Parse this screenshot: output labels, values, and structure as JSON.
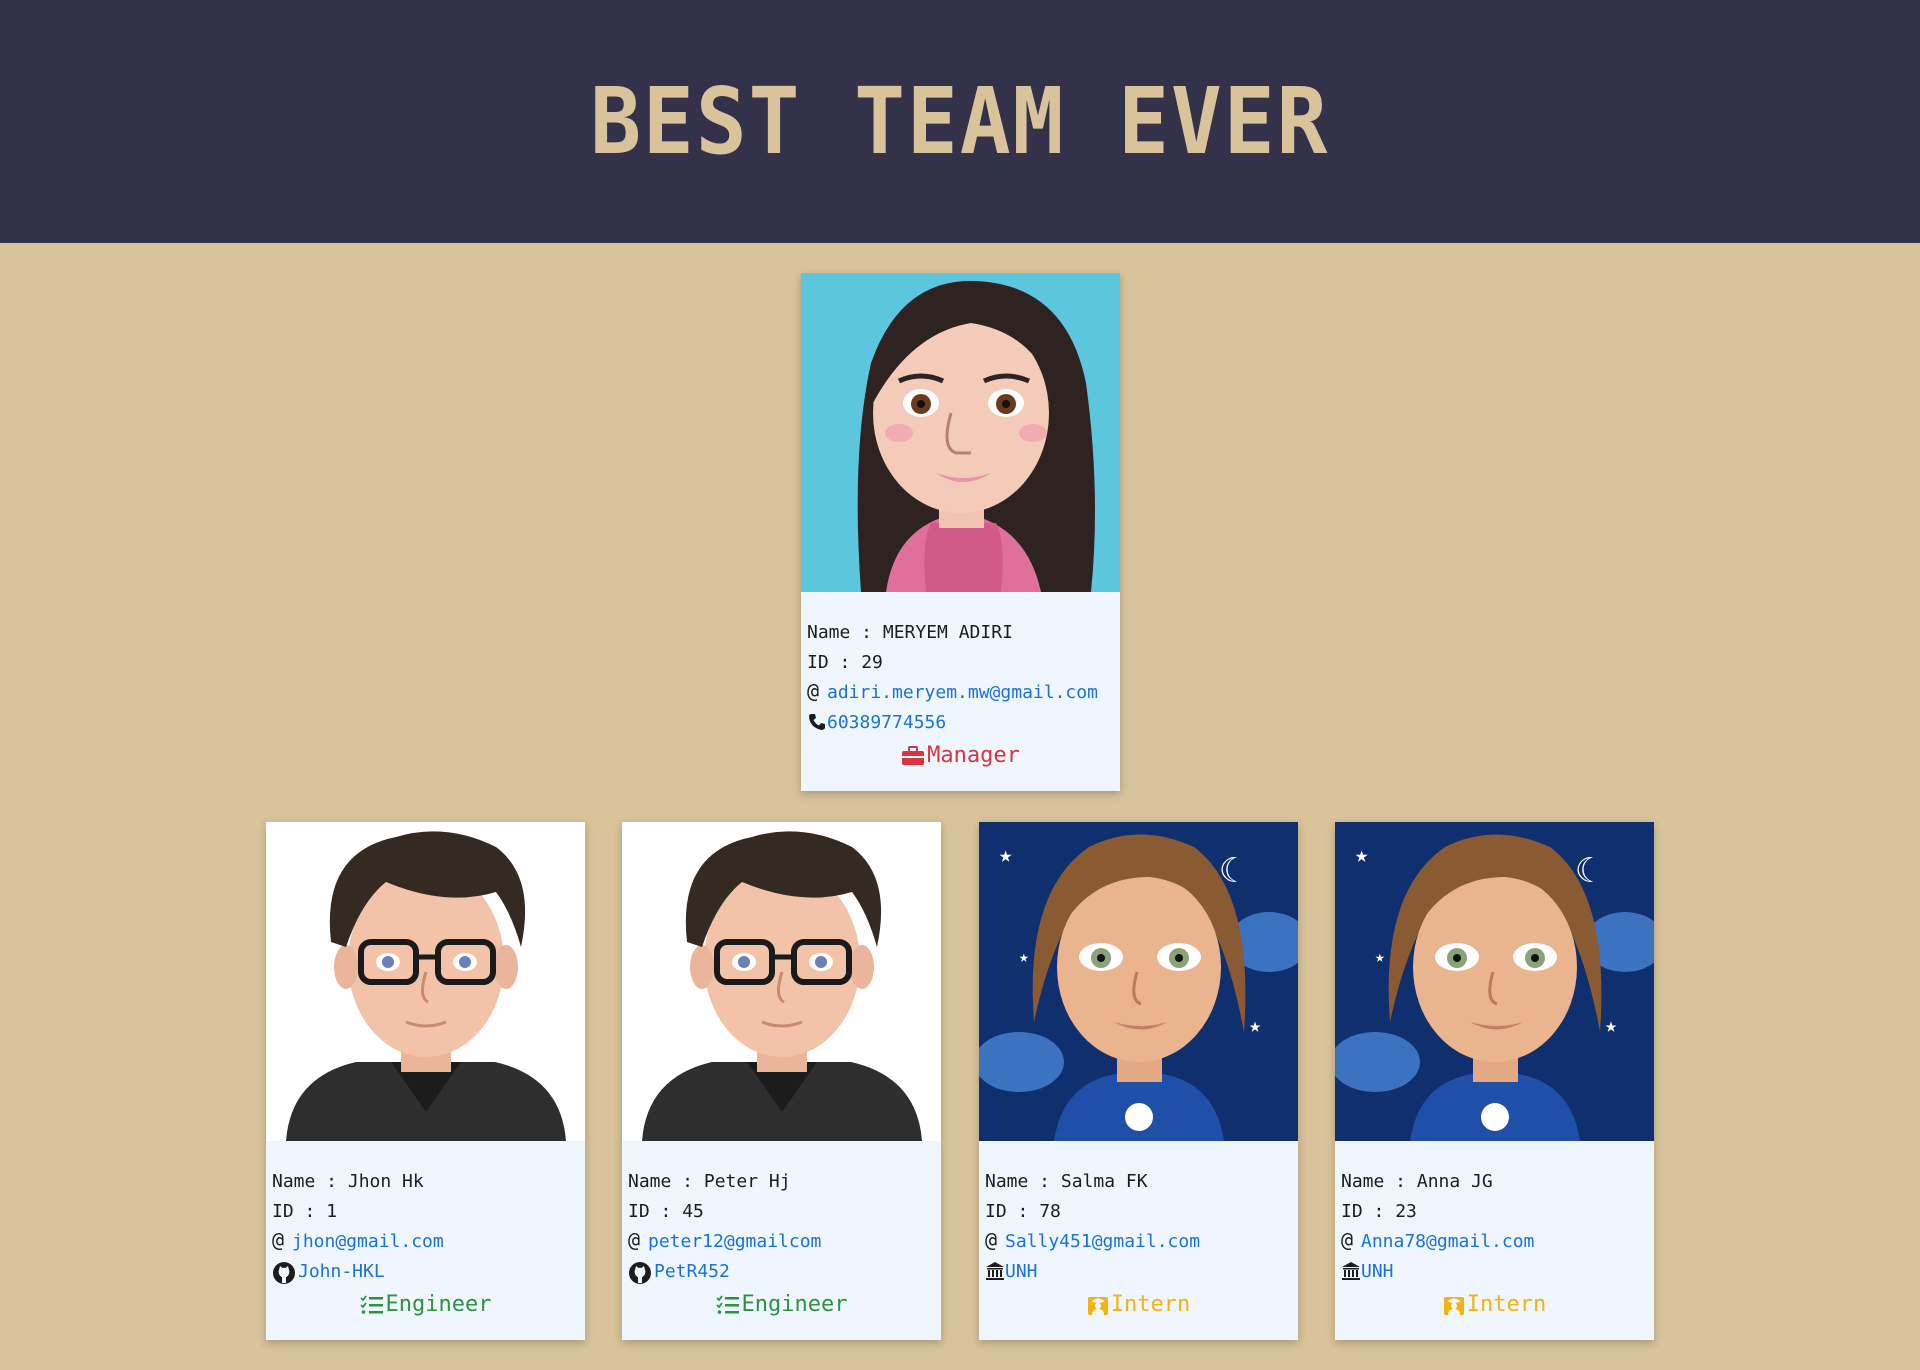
{
  "header": {
    "title": "BEST TEAM EVER"
  },
  "labels": {
    "name_prefix": "Name : ",
    "id_prefix": "ID : "
  },
  "manager": {
    "name": "MERYEM ADIRI",
    "id": "29",
    "email": "adiri.meryem.mw@gmail.com",
    "phone": "60389774556",
    "role": "Manager",
    "avatar": "female-avatar-dark-hair-icon"
  },
  "members": [
    {
      "name": "Jhon Hk",
      "id": "1",
      "email": "jhon@gmail.com",
      "extra": "John-HKL",
      "extra_icon": "github-icon",
      "role": "Engineer",
      "avatar": "male-avatar-glasses-icon"
    },
    {
      "name": "Peter Hj",
      "id": "45",
      "email": "peter12@gmailcom",
      "extra": "PetR452",
      "extra_icon": "github-icon",
      "role": "Engineer",
      "avatar": "male-avatar-glasses-icon"
    },
    {
      "name": "Salma FK",
      "id": "78",
      "email": "Sally451@gmail.com",
      "extra": "UNH",
      "extra_icon": "university-icon",
      "role": "Intern",
      "avatar": "female-avatar-night-sky-icon"
    },
    {
      "name": "Anna JG",
      "id": "23",
      "email": "Anna78@gmail.com",
      "extra": "UNH",
      "extra_icon": "university-icon",
      "role": "Intern",
      "avatar": "female-avatar-night-sky-icon"
    }
  ],
  "colors": {
    "header_bg": "#34314a",
    "page_bg": "#d8c39a",
    "card_bg": "#eff6fd",
    "link": "#1a72d6",
    "manager": "#d8353f",
    "engineer": "#2e9340",
    "intern": "#f4b30e"
  }
}
